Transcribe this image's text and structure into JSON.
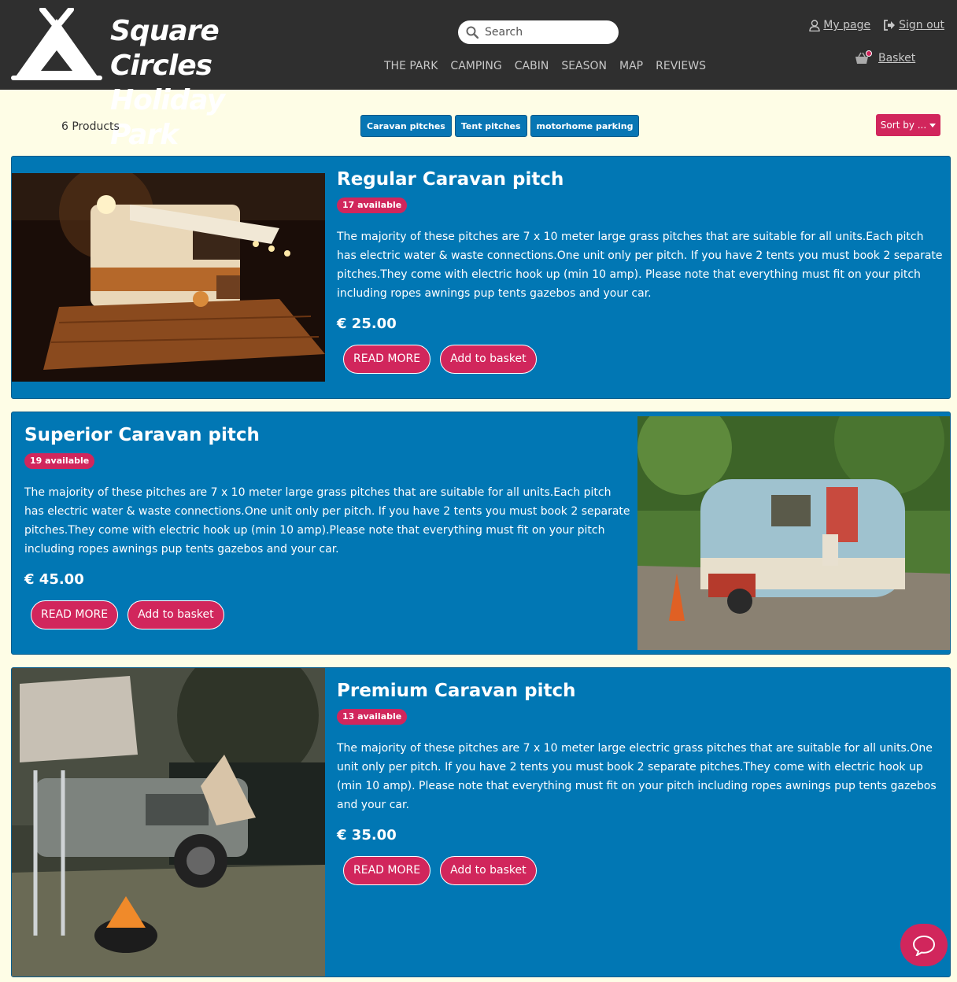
{
  "brand": {
    "line1": "Square Circles",
    "line2": "Holiday Park"
  },
  "search": {
    "placeholder": "Search"
  },
  "nav": [
    "THE PARK",
    "CAMPING",
    "CABIN",
    "SEASON",
    "MAP",
    "REVIEWS"
  ],
  "user": {
    "my_page": "My page",
    "sign_out": "Sign out",
    "basket": "Basket"
  },
  "toolbar": {
    "count": "6 Products",
    "filters": [
      "Caravan pitches",
      "Tent pitches",
      "motorhome parking"
    ],
    "sort_label": "Sort by ..."
  },
  "products": [
    {
      "title": "Regular Caravan pitch",
      "availability": "17 available",
      "description": "The majority of these pitches are 7 x 10 meter large grass pitches that are suitable for all units.Each pitch has electric water & waste connections.One unit only per pitch. If you have 2 tents you must book 2 separate pitches.They come with electric hook up (min 10 amp). Please note that everything must fit on your pitch including ropes awnings pup tents gazebos and your car.",
      "price": "€ 25.00",
      "read_more": "READ MORE",
      "add_to_basket": "Add to basket"
    },
    {
      "title": "Superior Caravan pitch",
      "availability": "19 available",
      "description": "The majority of these pitches are 7 x 10 meter large grass pitches that are suitable for all units.Each pitch has electric water & waste connections.One unit only per pitch. If you have 2 tents you must book 2 separate pitches.They come with electric hook up (min 10 amp).Please note that everything must fit on your pitch including ropes awnings pup tents gazebos and your car.",
      "price": "€ 45.00",
      "read_more": "READ MORE",
      "add_to_basket": "Add to basket"
    },
    {
      "title": "Premium Caravan pitch",
      "availability": "13 available",
      "description": "The majority of these pitches are 7 x 10 meter large electric grass pitches that are suitable for all units.One unit only per pitch. If you have 2 tents you must book 2 separate pitches.They come with electric hook up (min 10 amp). Please note that everything must fit on your pitch including ropes awnings pup tents gazebos and your car.",
      "price": "€ 35.00",
      "read_more": "READ MORE",
      "add_to_basket": "Add to basket"
    }
  ],
  "colors": {
    "header": "#2f2f2f",
    "card": "#0177b4",
    "accent": "#d1265c",
    "page": "#fefde6"
  },
  "icons": [
    "search-icon",
    "user-icon",
    "sign-out-icon",
    "basket-icon",
    "caret-down-icon",
    "chat-icon"
  ]
}
